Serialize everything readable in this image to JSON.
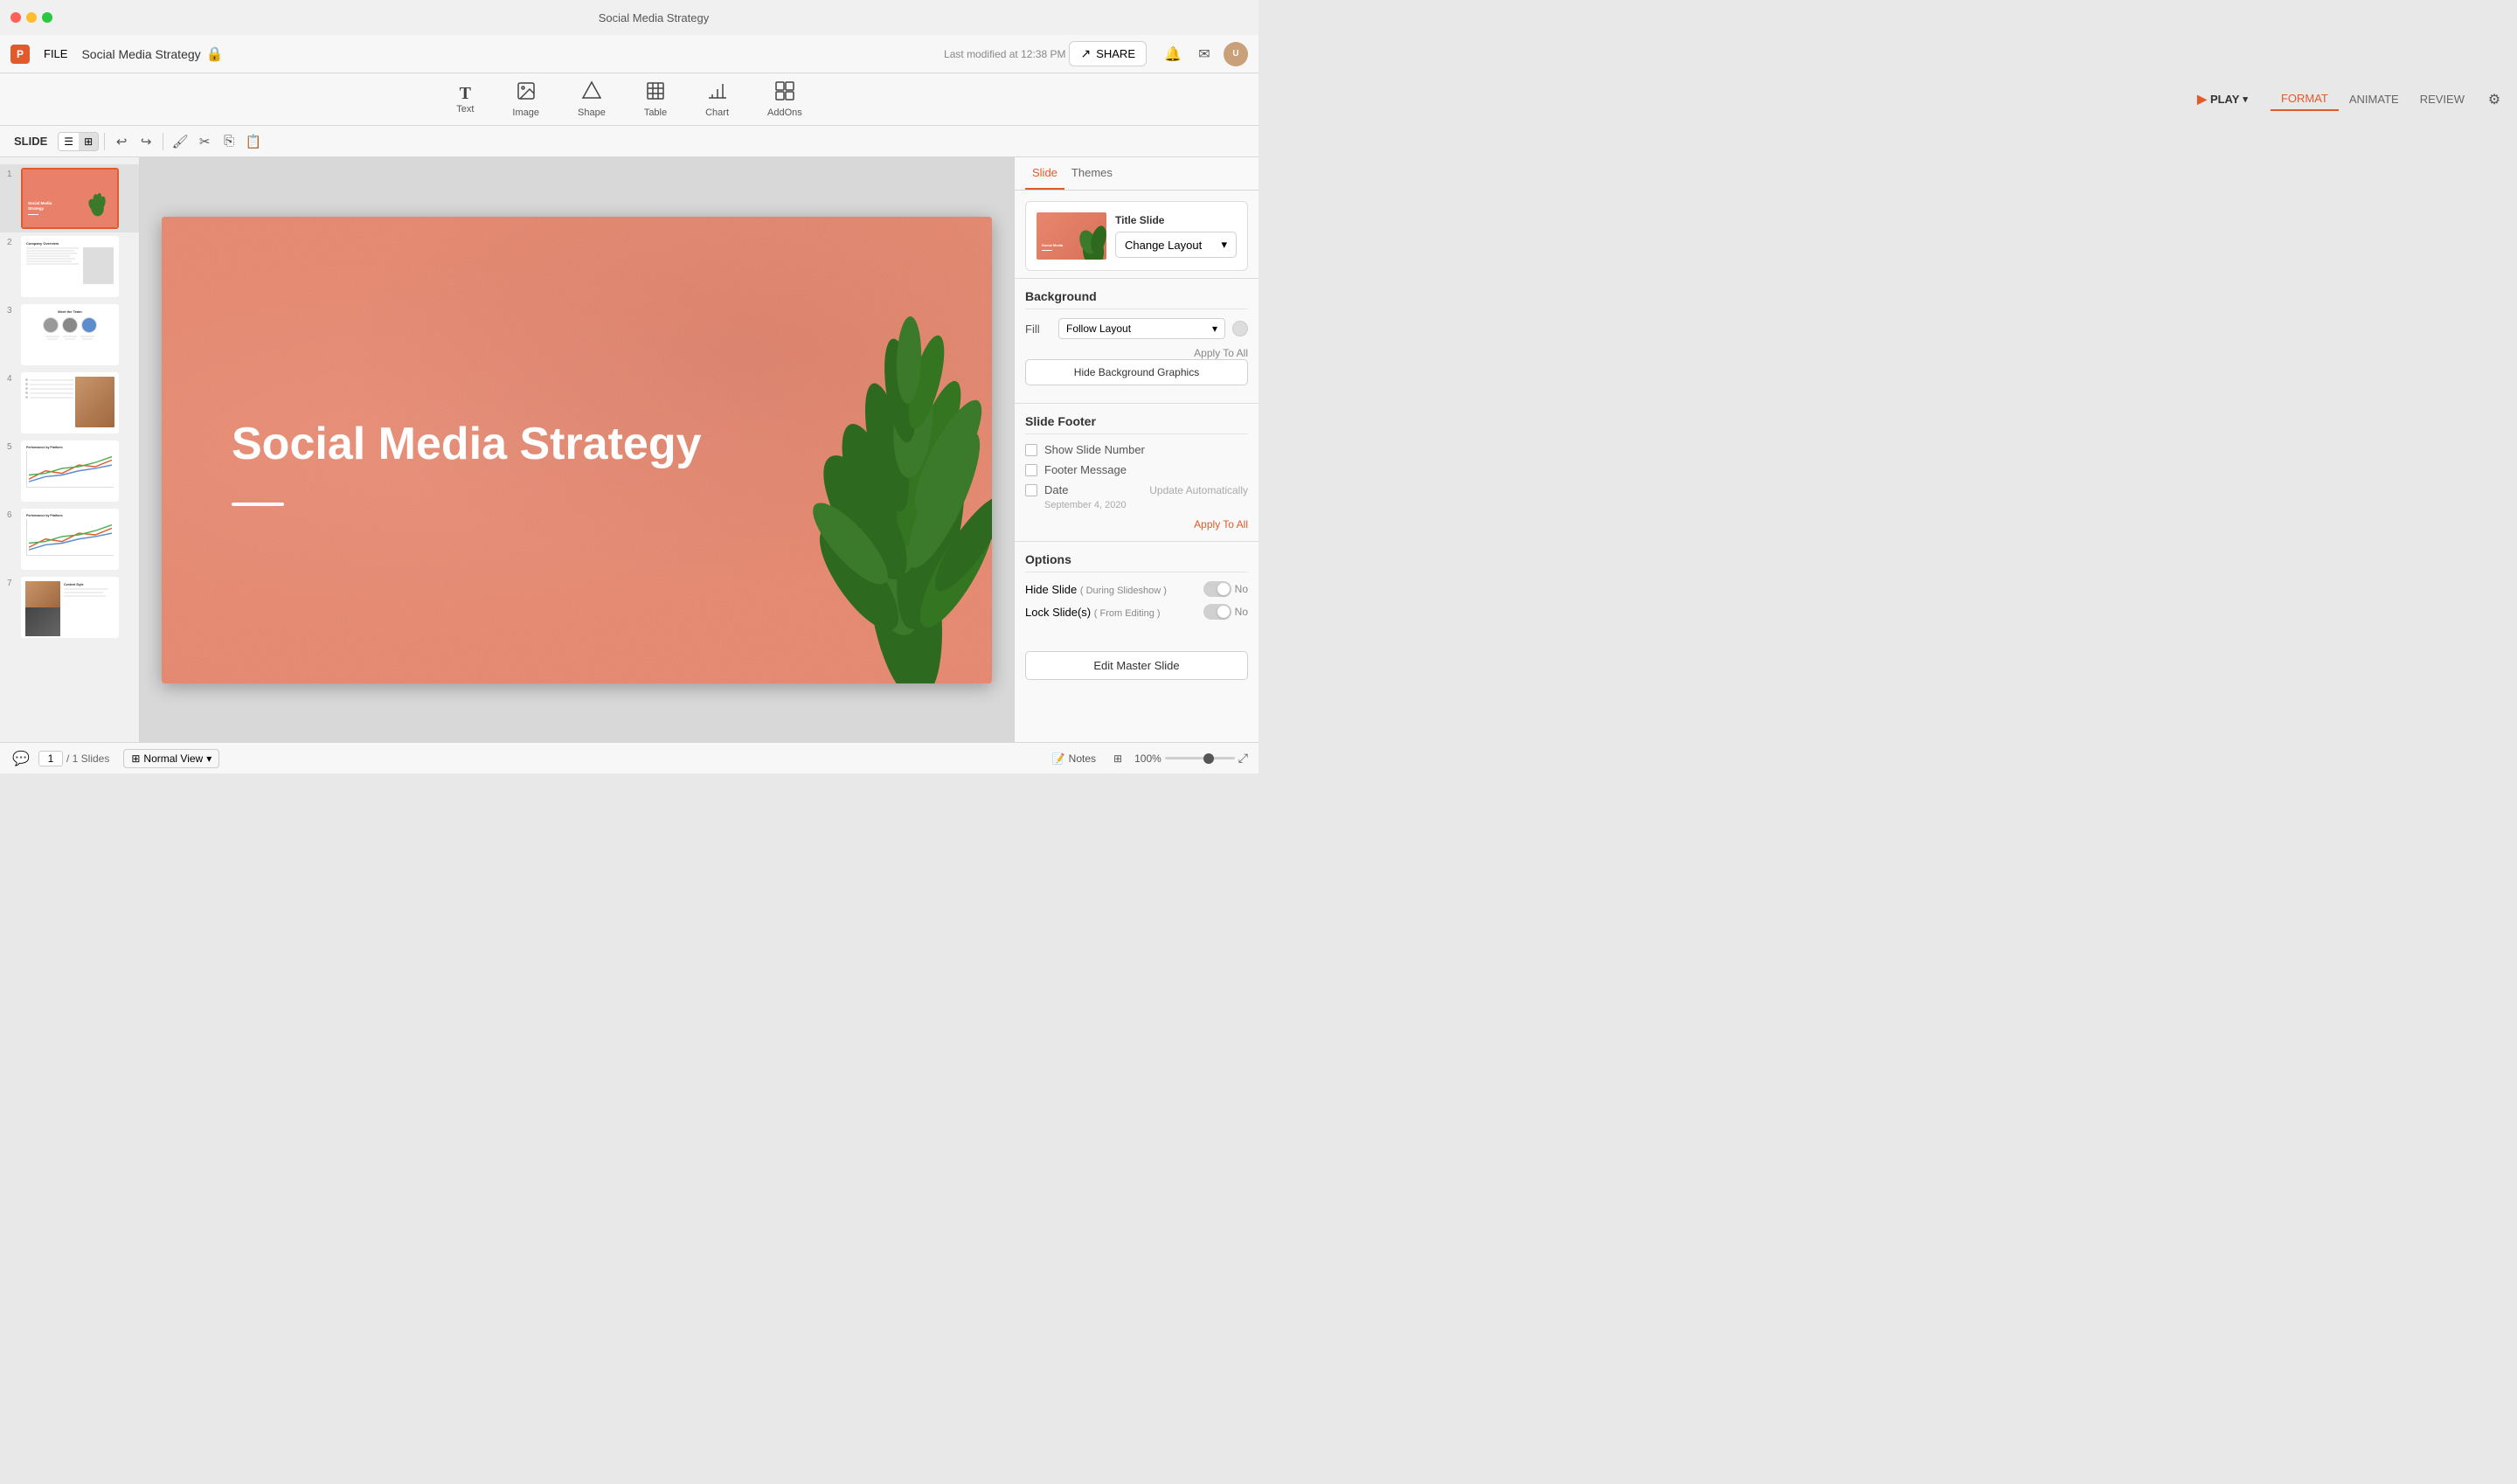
{
  "app": {
    "title": "Social Media Strategy",
    "file_label": "FILE",
    "last_modified": "Last modified at 12:38 PM"
  },
  "toolbar": {
    "slide_label": "SLIDE",
    "play_label": "PLAY",
    "format_label": "FORMAT",
    "animate_label": "ANIMATE",
    "review_label": "REVIEW"
  },
  "insert_tools": [
    {
      "id": "text",
      "label": "Text",
      "icon": "T"
    },
    {
      "id": "image",
      "label": "Image",
      "icon": "🖼"
    },
    {
      "id": "shape",
      "label": "Shape",
      "icon": "⬡"
    },
    {
      "id": "table",
      "label": "Table",
      "icon": "⊞"
    },
    {
      "id": "chart",
      "label": "Chart",
      "icon": "📊"
    },
    {
      "id": "addons",
      "label": "AddOns",
      "icon": "⊕"
    }
  ],
  "slide_panel": {
    "slides": [
      {
        "num": 1,
        "type": "title",
        "active": true
      },
      {
        "num": 2,
        "type": "content"
      },
      {
        "num": 3,
        "type": "team"
      },
      {
        "num": 4,
        "type": "text-image"
      },
      {
        "num": 5,
        "type": "chart1"
      },
      {
        "num": 6,
        "type": "chart2"
      },
      {
        "num": 7,
        "type": "content-style"
      }
    ]
  },
  "current_slide": {
    "title": "Social Media Strategy"
  },
  "right_panel": {
    "tabs": [
      "Slide",
      "Themes"
    ],
    "active_tab": "Slide",
    "layout_section": {
      "title": "Title Slide",
      "change_layout_label": "Change Layout"
    },
    "background": {
      "title": "Background",
      "fill_label": "Fill",
      "fill_option": "Follow Layout",
      "apply_to_all": "Apply To All",
      "hide_bg_btn": "Hide Background Graphics"
    },
    "slide_footer": {
      "title": "Slide Footer",
      "show_slide_number_label": "Show Slide Number",
      "footer_message_label": "Footer Message",
      "date_label": "Date",
      "update_auto_label": "Update Automatically",
      "date_value": "September 4, 2020",
      "apply_to_all": "Apply To All"
    },
    "options": {
      "title": "Options",
      "hide_slide_label": "Hide Slide",
      "hide_slide_sub": "( During Slideshow )",
      "hide_slide_no": "No",
      "lock_slide_label": "Lock Slide(s)",
      "lock_slide_sub": "( From Editing )",
      "lock_slide_no": "No"
    },
    "edit_master_btn": "Edit Master Slide"
  },
  "bottom_bar": {
    "page_num": "1",
    "page_total": "/ 1 Slides",
    "view_label": "Normal View",
    "notes_label": "Notes",
    "zoom_level": "100%"
  },
  "share_btn": "SHARE"
}
